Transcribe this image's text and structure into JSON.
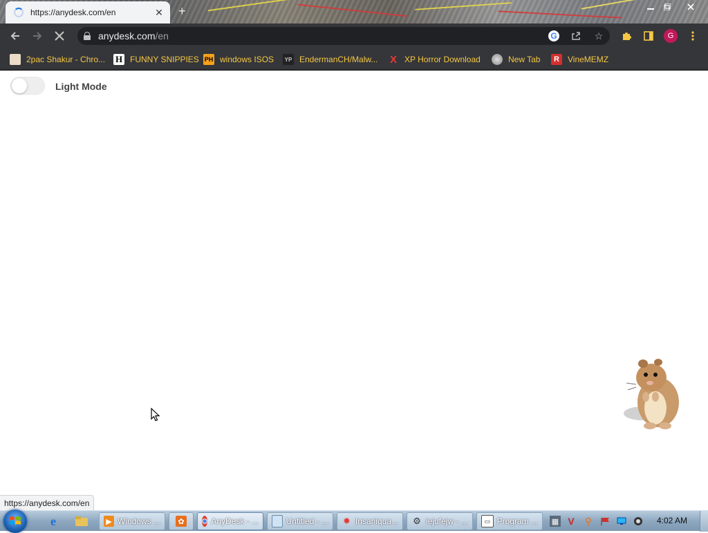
{
  "browser": {
    "tab": {
      "title": "https://anydesk.com/en",
      "close": "✕"
    },
    "new_tab": "+",
    "address": {
      "host": "anydesk.com",
      "path": "/en"
    },
    "profile_initial": "G",
    "status_url": "https://anydesk.com/en"
  },
  "bookmarks": [
    {
      "icon": "bookmark-folder-icon",
      "label": "2pac Shakur - Chro..."
    },
    {
      "icon": "h-icon",
      "label": "FUNNY SNIPPIES"
    },
    {
      "icon": "ph-icon",
      "label": "windows ISOS"
    },
    {
      "icon": "yp-icon",
      "label": "EndermanCH/Malw..."
    },
    {
      "icon": "x-icon",
      "label": "XP Horror Download"
    },
    {
      "icon": "globe-icon",
      "label": "New Tab"
    },
    {
      "icon": "r-icon",
      "label": "VineMEMZ"
    }
  ],
  "page": {
    "toggle_label": "Light Mode"
  },
  "taskbar": {
    "tasks": [
      {
        "icon": "media-player-icon",
        "label": "Windows ..."
      },
      {
        "icon": "app-icon",
        "label": ""
      },
      {
        "icon": "chrome-icon",
        "label": "AnyDesk - ..."
      },
      {
        "icon": "notepad-icon",
        "label": "Untitled - ..."
      },
      {
        "icon": "insaniquarium-icon",
        "label": "Insaniqua..."
      },
      {
        "icon": "gear-icon",
        "label": "iejufejw - ..."
      },
      {
        "icon": "program-manager-icon",
        "label": "Program ..."
      }
    ],
    "clock": "4:02 AM"
  },
  "colors": {
    "toolbar": "#35363a",
    "bookmark_text": "#f6c744",
    "profile": "#c2185b"
  }
}
